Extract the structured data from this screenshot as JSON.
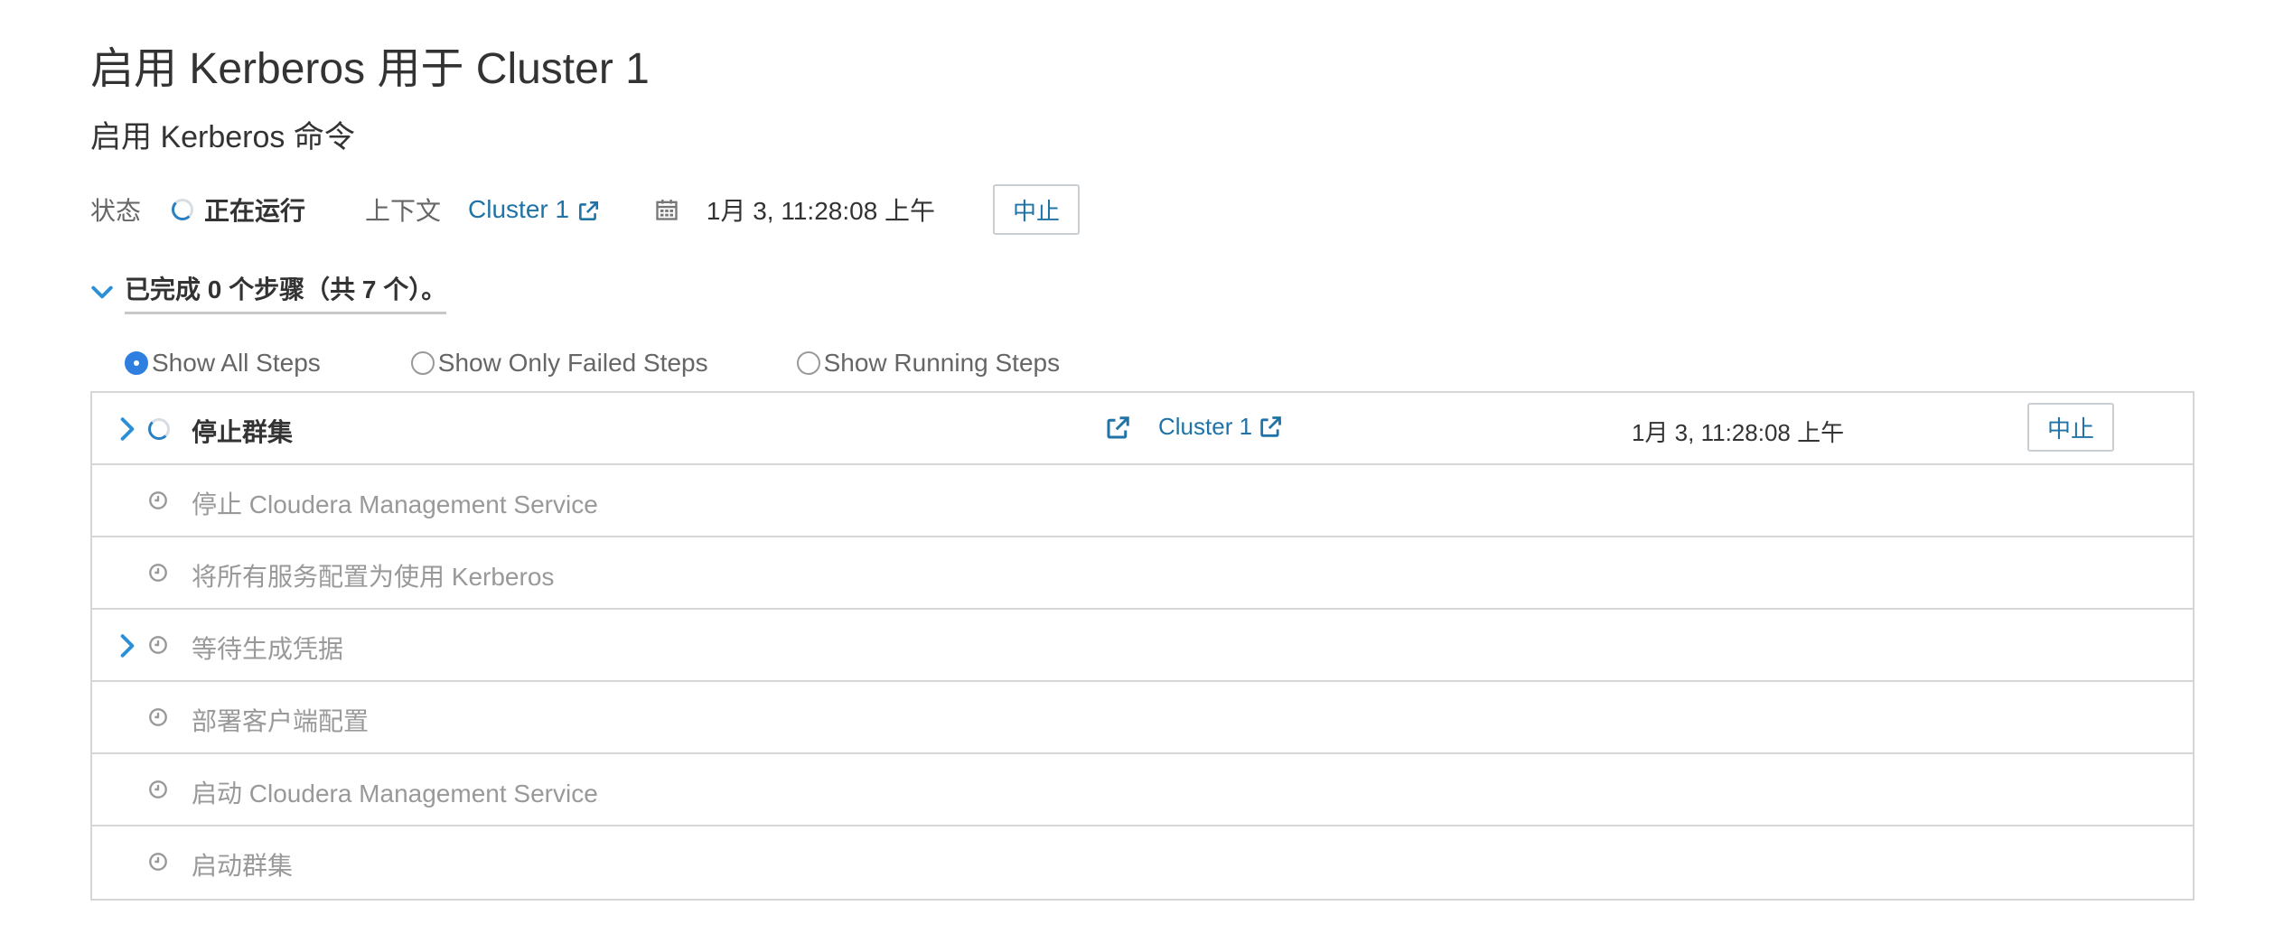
{
  "page": {
    "title": "启用 Kerberos 用于 Cluster 1",
    "subtitle": "启用 Kerberos 命令"
  },
  "status_bar": {
    "status_label": "状态",
    "status_value": "正在运行",
    "context_label": "上下文",
    "context_link": "Cluster 1",
    "timestamp": "1月 3, 11:28:08 上午",
    "abort_label": "中止"
  },
  "progress": {
    "summary": "已完成 0 个步骤（共 7 个）。"
  },
  "filters": {
    "options": [
      {
        "label": "Show All Steps",
        "checked": true
      },
      {
        "label": "Show Only Failed Steps",
        "checked": false
      },
      {
        "label": "Show Running Steps",
        "checked": false
      }
    ]
  },
  "steps": [
    {
      "label": "停止群集",
      "state": "running",
      "expandable": true,
      "context_link": "Cluster 1",
      "timestamp": "1月 3, 11:28:08 上午",
      "abort_label": "中止"
    },
    {
      "label": "停止 Cloudera Management Service",
      "state": "pending",
      "expandable": false
    },
    {
      "label": "将所有服务配置为使用 Kerberos",
      "state": "pending",
      "expandable": false
    },
    {
      "label": "等待生成凭据",
      "state": "pending",
      "expandable": true
    },
    {
      "label": "部署客户端配置",
      "state": "pending",
      "expandable": false
    },
    {
      "label": "启动 Cloudera Management Service",
      "state": "pending",
      "expandable": false
    },
    {
      "label": "启动群集",
      "state": "pending",
      "expandable": false
    }
  ],
  "colors": {
    "link": "#1f73a6",
    "chevron": "#2a8fd6",
    "muted_text": "#999999",
    "border": "#d6d6d6"
  },
  "icons": [
    "spinner-icon",
    "external-link-icon",
    "calendar-icon",
    "chevron-down-icon",
    "chevron-right-icon",
    "clock-icon"
  ]
}
